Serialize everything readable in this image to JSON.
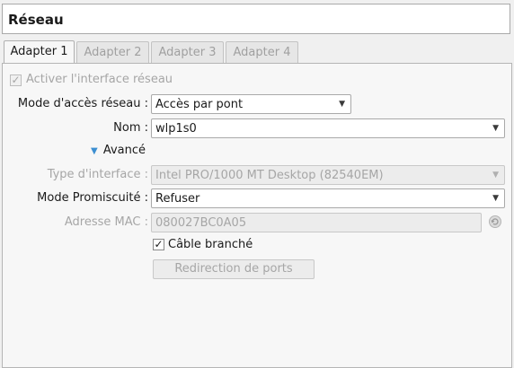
{
  "section": {
    "title": "Réseau"
  },
  "tabs": [
    {
      "label": "Adapter 1"
    },
    {
      "label": "Adapter 2"
    },
    {
      "label": "Adapter 3"
    },
    {
      "label": "Adapter 4"
    }
  ],
  "enable_adapter": {
    "label": "Activer l'interface réseau",
    "checked": true
  },
  "attached_to": {
    "label": "Mode d'accès réseau :",
    "value": "Accès par pont"
  },
  "name": {
    "label": "Nom :",
    "value": "wlp1s0"
  },
  "advanced": {
    "label": "Avancé"
  },
  "adapter_type": {
    "label": "Type d'interface :",
    "value": "Intel PRO/1000 MT Desktop (82540EM)"
  },
  "promiscuous": {
    "label": "Mode Promiscuité :",
    "value": "Refuser"
  },
  "mac": {
    "label": "Adresse MAC :",
    "value": "080027BC0A05"
  },
  "cable": {
    "label": "Câble branché",
    "checked": true
  },
  "port_forwarding": {
    "label": "Redirection de ports"
  },
  "icons": {
    "dropdown": "chevron-down-icon",
    "expand": "triangle-down-icon",
    "refresh": "refresh-icon",
    "check": "checkmark-icon"
  }
}
